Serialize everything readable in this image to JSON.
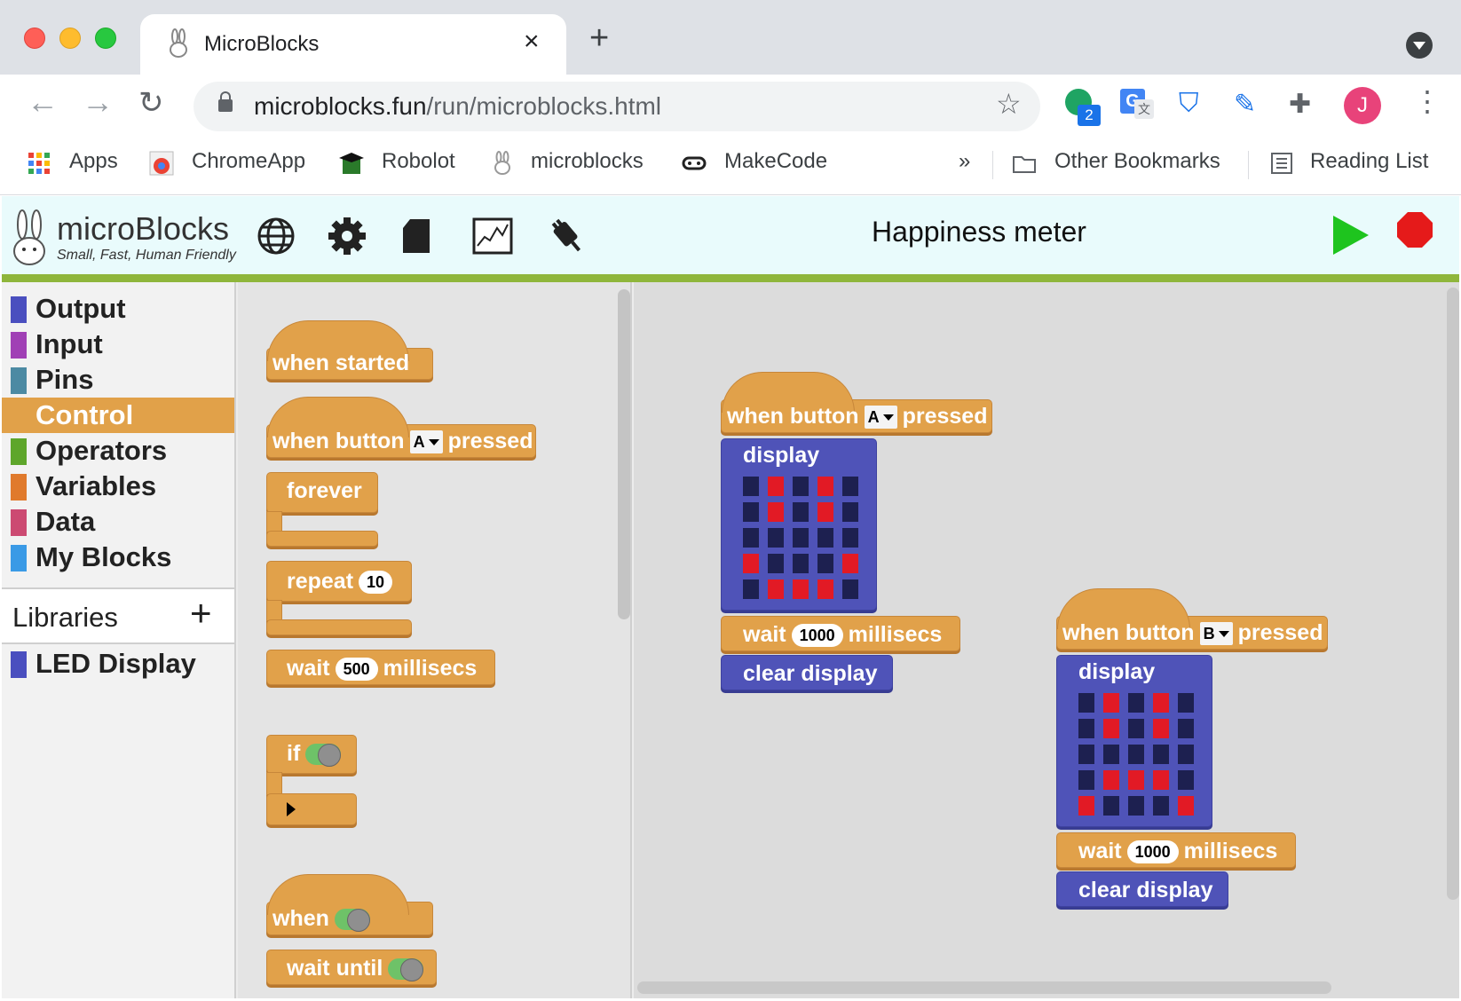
{
  "browser": {
    "tab_title": "MicroBlocks",
    "url_host": "microblocks.fun",
    "url_path": "/run/microblocks.html",
    "extension_badge": "2",
    "profile_initial": "J",
    "bookmarks": [
      {
        "label": "Apps",
        "icon": "apps-grid-icon"
      },
      {
        "label": "ChromeApp",
        "icon": "chrome-icon"
      },
      {
        "label": "Robolot",
        "icon": "robolot-icon"
      },
      {
        "label": "microblocks",
        "icon": "bunny-icon"
      },
      {
        "label": "MakeCode",
        "icon": "makecode-icon"
      }
    ],
    "overflow": "»",
    "other_bookmarks": "Other Bookmarks",
    "reading_list": "Reading List"
  },
  "app": {
    "logo_title": "microBlocks",
    "logo_subtitle": "Small, Fast, Human Friendly",
    "project_title": "Happiness meter",
    "toolbar_icons": [
      "globe-icon",
      "gear-icon",
      "file-icon",
      "graph-icon",
      "usb-plug-icon"
    ],
    "categories": [
      {
        "label": "Output",
        "color": "#4a4fbf",
        "selected": false
      },
      {
        "label": "Input",
        "color": "#a040b5",
        "selected": false
      },
      {
        "label": "Pins",
        "color": "#4c8aa3",
        "selected": false
      },
      {
        "label": "Control",
        "color": "#e1a149",
        "selected": true
      },
      {
        "label": "Operators",
        "color": "#5ea62b",
        "selected": false
      },
      {
        "label": "Variables",
        "color": "#e07a2c",
        "selected": false
      },
      {
        "label": "Data",
        "color": "#cc4a72",
        "selected": false
      },
      {
        "label": "My Blocks",
        "color": "#3a9ae6",
        "selected": false
      }
    ],
    "libraries_label": "Libraries",
    "libraries_add": "+",
    "libraries": [
      {
        "label": "LED Display",
        "color": "#4a4fbf"
      }
    ],
    "palette": {
      "when_started": "when started",
      "when_button": "when button",
      "button_a": "A",
      "pressed": "pressed",
      "forever": "forever",
      "repeat": "repeat",
      "repeat_count": "10",
      "wait": "wait",
      "wait_ms": "500",
      "millisecs": "millisecs",
      "if": "if",
      "when": "when",
      "wait_until": "wait until"
    },
    "scripts": [
      {
        "hat_label": "when button",
        "button": "A",
        "pressed": "pressed",
        "display_label": "display",
        "matrix": [
          [
            0,
            1,
            0,
            1,
            0
          ],
          [
            0,
            1,
            0,
            1,
            0
          ],
          [
            0,
            0,
            0,
            0,
            0
          ],
          [
            1,
            0,
            0,
            0,
            1
          ],
          [
            0,
            1,
            1,
            1,
            0
          ]
        ],
        "wait_label": "wait",
        "wait_ms": "1000",
        "millisecs": "millisecs",
        "clear_label": "clear display"
      },
      {
        "hat_label": "when button",
        "button": "B",
        "pressed": "pressed",
        "display_label": "display",
        "matrix": [
          [
            0,
            1,
            0,
            1,
            0
          ],
          [
            0,
            1,
            0,
            1,
            0
          ],
          [
            0,
            0,
            0,
            0,
            0
          ],
          [
            0,
            1,
            1,
            1,
            0
          ],
          [
            1,
            0,
            0,
            0,
            1
          ]
        ],
        "wait_label": "wait",
        "wait_ms": "1000",
        "millisecs": "millisecs",
        "clear_label": "clear display"
      }
    ]
  }
}
